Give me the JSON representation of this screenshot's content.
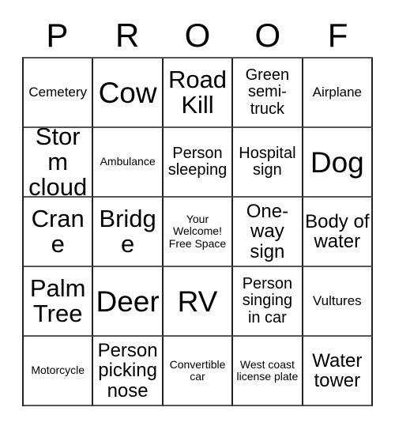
{
  "card": {
    "header_letters": [
      "P",
      "R",
      "O",
      "O",
      "F"
    ],
    "rows": [
      [
        {
          "text": "Cemetery",
          "size": "s"
        },
        {
          "text": "Cow",
          "size": "xxl"
        },
        {
          "text": "Road Kill",
          "size": "xl"
        },
        {
          "text": "Green semi-truck",
          "size": "m"
        },
        {
          "text": "Airplane",
          "size": "s"
        }
      ],
      [
        {
          "text": "Storm cloud",
          "size": "xl"
        },
        {
          "text": "Ambulance",
          "size": "xs"
        },
        {
          "text": "Person sleeping",
          "size": "m"
        },
        {
          "text": "Hospital sign",
          "size": "m"
        },
        {
          "text": "Dog",
          "size": "xxl"
        }
      ],
      [
        {
          "text": "Crane",
          "size": "xl"
        },
        {
          "text": "Bridge",
          "size": "xl"
        },
        {
          "text": "Your Welcome! Free Space",
          "size": "xs"
        },
        {
          "text": "One-way sign",
          "size": "l"
        },
        {
          "text": "Body of water",
          "size": "l"
        }
      ],
      [
        {
          "text": "Palm Tree",
          "size": "xl"
        },
        {
          "text": "Deer",
          "size": "xxl"
        },
        {
          "text": "RV",
          "size": "xxl"
        },
        {
          "text": "Person singing in car",
          "size": "m"
        },
        {
          "text": "Vultures",
          "size": "s"
        }
      ],
      [
        {
          "text": "Motorcycle",
          "size": "xs"
        },
        {
          "text": "Person picking nose",
          "size": "l"
        },
        {
          "text": "Convertible car",
          "size": "xs"
        },
        {
          "text": "West coast license plate",
          "size": "xs"
        },
        {
          "text": "Water tower",
          "size": "l"
        }
      ]
    ]
  }
}
